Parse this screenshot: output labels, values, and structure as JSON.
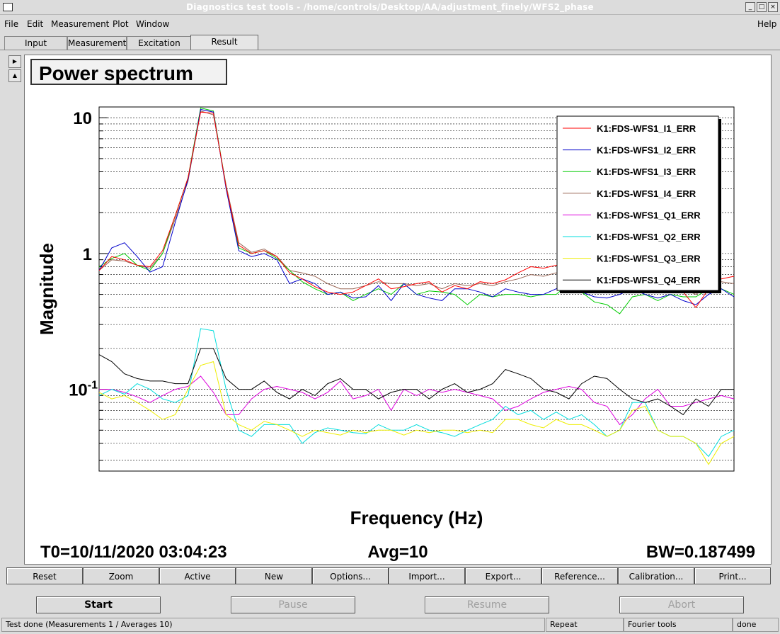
{
  "window": {
    "title": "Diagnostics test tools - /home/controls/Desktop/AA/adjustment_finely/WFS2_phase",
    "controls": [
      "minimize",
      "maximize",
      "close"
    ]
  },
  "menu": {
    "items": [
      "File",
      "Edit",
      "Measurement",
      "Plot",
      "Window"
    ],
    "help": "Help"
  },
  "tabs": [
    {
      "label": "Input",
      "active": false
    },
    {
      "label": "Measurement",
      "active": false
    },
    {
      "label": "Excitation",
      "active": false
    },
    {
      "label": "Result",
      "active": true
    }
  ],
  "plot": {
    "panel_title": "Power spectrum",
    "t0": "T0=10/11/2020 03:04:23",
    "avg": "Avg=10",
    "bw": "BW=0.187499"
  },
  "chart_data": {
    "type": "line",
    "title": "",
    "xlabel": "Frequency (Hz)",
    "ylabel": "Magnitude",
    "yscale": "log",
    "ylim": [
      0.025,
      12
    ],
    "yticks": [
      {
        "label": "10",
        "value": 10
      },
      {
        "label": "1",
        "value": 1
      },
      {
        "label": "10-1",
        "value": 0.1
      }
    ],
    "grid": true,
    "legend_position": "top-right",
    "x_index_count": 51,
    "series": [
      {
        "name": "K1:FDS-WFS1_I1_ERR",
        "color": "#ff0000",
        "values": [
          0.75,
          0.95,
          0.9,
          0.82,
          0.8,
          1.05,
          1.9,
          3.6,
          11.0,
          10.8,
          3.1,
          1.15,
          1.0,
          1.05,
          0.95,
          0.72,
          0.65,
          0.57,
          0.52,
          0.5,
          0.52,
          0.58,
          0.65,
          0.55,
          0.57,
          0.6,
          0.62,
          0.52,
          0.58,
          0.55,
          0.62,
          0.6,
          0.64,
          0.72,
          0.8,
          0.78,
          0.82,
          0.7,
          0.6,
          0.55,
          0.58,
          0.62,
          0.6,
          0.65,
          0.6,
          0.55,
          0.52,
          0.4,
          0.55,
          0.65,
          0.68
        ]
      },
      {
        "name": "K1:FDS-WFS1_I2_ERR",
        "color": "#0000cc",
        "values": [
          0.75,
          1.1,
          1.2,
          0.95,
          0.73,
          0.8,
          1.7,
          3.5,
          11.5,
          11.0,
          3.0,
          1.05,
          0.95,
          1.0,
          0.9,
          0.6,
          0.65,
          0.6,
          0.5,
          0.52,
          0.47,
          0.48,
          0.58,
          0.45,
          0.6,
          0.5,
          0.47,
          0.45,
          0.55,
          0.55,
          0.52,
          0.48,
          0.55,
          0.52,
          0.5,
          0.5,
          0.55,
          0.6,
          0.52,
          0.48,
          0.47,
          0.5,
          0.55,
          0.5,
          0.47,
          0.5,
          0.45,
          0.42,
          0.5,
          0.55,
          0.48
        ]
      },
      {
        "name": "K1:FDS-WFS1_I3_ERR",
        "color": "#00cc00",
        "values": [
          0.8,
          0.92,
          1.0,
          0.82,
          0.75,
          1.0,
          1.9,
          3.6,
          11.8,
          11.2,
          3.1,
          1.1,
          1.0,
          1.05,
          0.92,
          0.75,
          0.62,
          0.55,
          0.5,
          0.52,
          0.45,
          0.5,
          0.55,
          0.5,
          0.6,
          0.5,
          0.53,
          0.52,
          0.5,
          0.42,
          0.5,
          0.48,
          0.5,
          0.5,
          0.48,
          0.5,
          0.5,
          0.6,
          0.52,
          0.44,
          0.42,
          0.36,
          0.48,
          0.5,
          0.45,
          0.5,
          0.48,
          0.48,
          0.55,
          0.55,
          0.5
        ]
      },
      {
        "name": "K1:FDS-WFS1_I4_ERR",
        "color": "#996655",
        "values": [
          0.75,
          0.9,
          0.88,
          0.82,
          0.78,
          1.0,
          1.8,
          3.4,
          11.2,
          10.5,
          3.2,
          1.2,
          1.02,
          1.08,
          0.95,
          0.75,
          0.72,
          0.68,
          0.6,
          0.55,
          0.55,
          0.58,
          0.62,
          0.6,
          0.6,
          0.58,
          0.6,
          0.55,
          0.6,
          0.58,
          0.6,
          0.58,
          0.62,
          0.65,
          0.7,
          0.68,
          0.72,
          0.65,
          0.6,
          0.55,
          0.55,
          0.58,
          0.6,
          0.62,
          0.6,
          0.58,
          0.55,
          0.5,
          0.58,
          0.62,
          0.6
        ]
      },
      {
        "name": "K1:FDS-WFS1_Q1_ERR",
        "color": "#dd00dd",
        "values": [
          0.1,
          0.1,
          0.095,
          0.088,
          0.08,
          0.09,
          0.1,
          0.105,
          0.125,
          0.095,
          0.065,
          0.065,
          0.085,
          0.1,
          0.105,
          0.1,
          0.095,
          0.085,
          0.095,
          0.115,
          0.085,
          0.09,
          0.1,
          0.07,
          0.1,
          0.09,
          0.1,
          0.095,
          0.1,
          0.095,
          0.09,
          0.085,
          0.07,
          0.075,
          0.085,
          0.095,
          0.1,
          0.105,
          0.1,
          0.08,
          0.075,
          0.055,
          0.065,
          0.085,
          0.1,
          0.075,
          0.075,
          0.08,
          0.085,
          0.09,
          0.085
        ]
      },
      {
        "name": "K1:FDS-WFS1_Q2_ERR",
        "color": "#00dddd",
        "values": [
          0.09,
          0.1,
          0.092,
          0.11,
          0.1,
          0.085,
          0.08,
          0.09,
          0.28,
          0.27,
          0.1,
          0.05,
          0.045,
          0.055,
          0.055,
          0.055,
          0.04,
          0.048,
          0.052,
          0.05,
          0.048,
          0.047,
          0.055,
          0.05,
          0.05,
          0.055,
          0.05,
          0.048,
          0.045,
          0.05,
          0.055,
          0.06,
          0.075,
          0.065,
          0.07,
          0.06,
          0.068,
          0.06,
          0.065,
          0.055,
          0.045,
          0.05,
          0.08,
          0.08,
          0.05,
          0.045,
          0.045,
          0.04,
          0.032,
          0.045,
          0.05
        ]
      },
      {
        "name": "K1:FDS-WFS1_Q3_ERR",
        "color": "#eeee00",
        "values": [
          0.095,
          0.085,
          0.09,
          0.08,
          0.07,
          0.06,
          0.065,
          0.1,
          0.15,
          0.16,
          0.065,
          0.055,
          0.05,
          0.058,
          0.055,
          0.05,
          0.045,
          0.05,
          0.048,
          0.046,
          0.05,
          0.048,
          0.05,
          0.05,
          0.046,
          0.05,
          0.048,
          0.05,
          0.05,
          0.048,
          0.05,
          0.048,
          0.06,
          0.06,
          0.055,
          0.052,
          0.06,
          0.055,
          0.055,
          0.05,
          0.045,
          0.05,
          0.07,
          0.075,
          0.05,
          0.045,
          0.045,
          0.04,
          0.028,
          0.04,
          0.045
        ]
      },
      {
        "name": "K1:FDS-WFS1_Q4_ERR",
        "color": "#000000",
        "values": [
          0.18,
          0.16,
          0.13,
          0.12,
          0.115,
          0.115,
          0.11,
          0.11,
          0.2,
          0.2,
          0.12,
          0.1,
          0.1,
          0.115,
          0.095,
          0.085,
          0.1,
          0.09,
          0.11,
          0.12,
          0.1,
          0.1,
          0.085,
          0.095,
          0.1,
          0.1,
          0.085,
          0.1,
          0.11,
          0.095,
          0.1,
          0.11,
          0.14,
          0.13,
          0.12,
          0.1,
          0.095,
          0.085,
          0.11,
          0.125,
          0.12,
          0.1,
          0.085,
          0.08,
          0.085,
          0.075,
          0.065,
          0.085,
          0.075,
          0.1,
          0.1
        ]
      }
    ]
  },
  "plot_buttons": [
    "Reset",
    "Zoom",
    "Active",
    "New",
    "Options...",
    "Import...",
    "Export...",
    "Reference...",
    "Calibration...",
    "Print..."
  ],
  "control_buttons": [
    {
      "label": "Start",
      "enabled": true
    },
    {
      "label": "Pause",
      "enabled": false
    },
    {
      "label": "Resume",
      "enabled": false
    },
    {
      "label": "Abort",
      "enabled": false
    }
  ],
  "status": {
    "message": "Test done (Measurements 1 / Averages 10)",
    "mode": "Repeat",
    "tool": "Fourier tools",
    "state": "done"
  }
}
